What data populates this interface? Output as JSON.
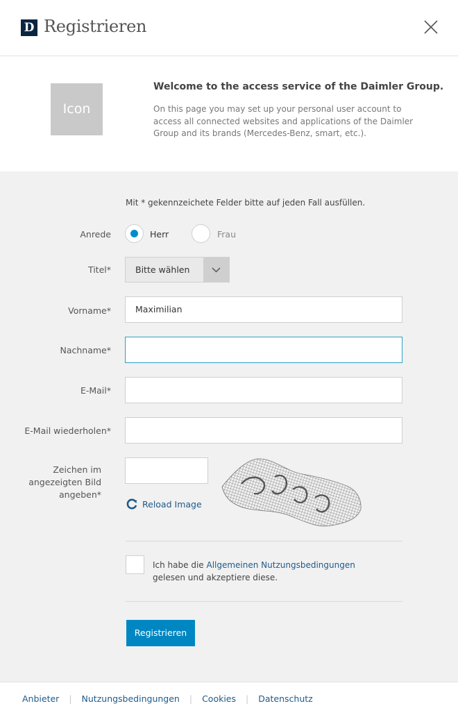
{
  "header": {
    "logo_letter": "D",
    "title": "Registrieren"
  },
  "intro": {
    "icon_label": "Icon",
    "title": "Welcome to the access service of the Daimler Group.",
    "text": "On this page you may set up your personal user account to access all connected websites and applications of the Daimler Group and its brands (Mercedes-Benz, smart, etc.)."
  },
  "form": {
    "hint": "Mit * gekennzeichete Felder bitte auf jeden Fall ausfüllen.",
    "anrede": {
      "label": "Anrede",
      "options": [
        "Herr",
        "Frau"
      ],
      "selected": "Herr"
    },
    "titel": {
      "label": "Titel*",
      "value": "Bitte wählen"
    },
    "vorname": {
      "label": "Vorname*",
      "value": "Maximilian"
    },
    "nachname": {
      "label": "Nachname*",
      "value": ""
    },
    "email": {
      "label": "E-Mail*",
      "value": ""
    },
    "email_repeat": {
      "label": "E-Mail wiederholen*",
      "value": ""
    },
    "captcha": {
      "label_line1": "Zeichen im",
      "label_line2": "angezeigten Bild",
      "label_line3": "angeben*",
      "value": "",
      "reload_label": "Reload Image"
    },
    "terms": {
      "prefix": "Ich habe die ",
      "link": "Allgemeinen Nutzungsbedingungen",
      "suffix": "gelesen und akzeptiere diese."
    },
    "submit_label": "Registrieren"
  },
  "footer": {
    "links": [
      "Anbieter",
      "Nutzungsbedingungen",
      "Cookies",
      "Datenschutz"
    ]
  },
  "colors": {
    "accent": "#0087c1",
    "radio_dot": "#008dc9",
    "link": "#1d5a8a",
    "logo_bg": "#0a2540"
  }
}
